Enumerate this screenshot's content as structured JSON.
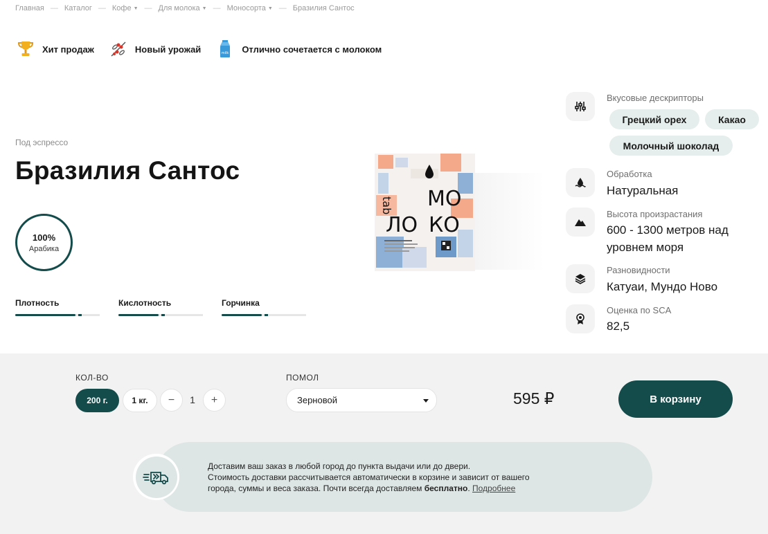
{
  "breadcrumb": [
    {
      "label": "Главная",
      "dropdown": false
    },
    {
      "label": "Каталог",
      "dropdown": false
    },
    {
      "label": "Кофе",
      "dropdown": true
    },
    {
      "label": "Для молока",
      "dropdown": true
    },
    {
      "label": "Моносорта",
      "dropdown": true
    },
    {
      "label": "Бразилия Сантос",
      "dropdown": false
    }
  ],
  "badges": [
    {
      "icon": "trophy-icon",
      "label": "Хит продаж"
    },
    {
      "icon": "coffee-branch-icon",
      "label": "Новый урожай"
    },
    {
      "icon": "milk-carton-icon",
      "label": "Отлично сочетается с молоком"
    }
  ],
  "product": {
    "subtitle": "Под эспрессо",
    "title": "Бразилия Сантос",
    "arabica_pct": "100%",
    "arabica_label": "Арабика",
    "scales": [
      {
        "name": "Плотность",
        "level": 0.75
      },
      {
        "name": "Кислотность",
        "level": 0.5
      },
      {
        "name": "Горчинка",
        "level": 0.5
      }
    ],
    "package": {
      "brand": "tab",
      "word_top": "МО",
      "word_bottom_left": "ЛО",
      "word_bottom_right": "КО"
    }
  },
  "attributes": {
    "descriptors_label": "Вкусовые дескрипторы",
    "descriptors": [
      "Грецкий орех",
      "Какао",
      "Молочный шоколад"
    ],
    "processing_label": "Обработка",
    "processing_value": "Натуральная",
    "altitude_label": "Высота произрастания",
    "altitude_value": "600 - 1300 метров над уровнем моря",
    "varieties_label": "Разновидности",
    "varieties_value": "Катуаи, Мундо Ново",
    "sca_label": "Оценка по SCA",
    "sca_value": "82,5"
  },
  "purchase": {
    "qty_label": "КОЛ-ВО",
    "sizes": [
      "200 г.",
      "1 кг."
    ],
    "selected_size": "200 г.",
    "minus": "−",
    "plus": "+",
    "quantity": "1",
    "grind_label": "ПОМОЛ",
    "grind_value": "Зерновой",
    "price": "595 ₽",
    "cart_label": "В корзину"
  },
  "delivery": {
    "line1": "Доставим ваш заказ в любой город до пункта выдачи или до двери.",
    "line2": "Стоимость доставки рассчитывается автоматически в корзине и зависит от вашего",
    "line3_start": "города, суммы и веса заказа. Почти всегда доставляем ",
    "line3_bold": "бесплатно",
    "line3_end": ". ",
    "link": "Подробнее"
  },
  "colors": {
    "accent": "#144b4b",
    "chip_bg": "#e5eeec",
    "delivery_bg": "#dde6e5",
    "buybar_bg": "#f2f2f2"
  }
}
